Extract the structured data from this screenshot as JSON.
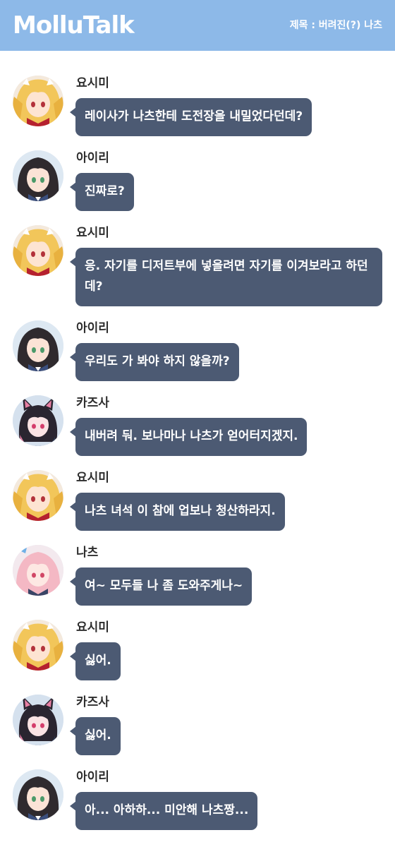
{
  "header": {
    "app_title": "MolluTalk",
    "subject": "제목 : 버려진(?) 나츠"
  },
  "messages": [
    {
      "sender": "요시미",
      "avatar_icon": "yoshimi-avatar-icon",
      "text": "레이사가 나츠한테 도전장을 내밀었다던데?"
    },
    {
      "sender": "아이리",
      "avatar_icon": "airi-avatar-icon",
      "text": "진짜로?"
    },
    {
      "sender": "요시미",
      "avatar_icon": "yoshimi-avatar-icon",
      "text": "응. 자기를 디저트부에 넣을려면 자기를 이겨보라고 하던데?"
    },
    {
      "sender": "아이리",
      "avatar_icon": "airi-avatar-icon",
      "text": "우리도 가 봐야 하지 않을까?"
    },
    {
      "sender": "카즈사",
      "avatar_icon": "kazusa-avatar-icon",
      "text": "내버려 둬. 보나마나 나츠가 얻어터지겠지."
    },
    {
      "sender": "요시미",
      "avatar_icon": "yoshimi-avatar-icon",
      "text": "나츠 녀석 이 참에 업보나 청산하라지."
    },
    {
      "sender": "나츠",
      "avatar_icon": "natsu-avatar-icon",
      "text": "여~ 모두들 나 좀 도와주게나~"
    },
    {
      "sender": "요시미",
      "avatar_icon": "yoshimi-avatar-icon",
      "text": "싫어."
    },
    {
      "sender": "카즈사",
      "avatar_icon": "kazusa-avatar-icon",
      "text": "싫어."
    },
    {
      "sender": "아이리",
      "avatar_icon": "airi-avatar-icon",
      "text": "아... 아하하... 미안해 나츠짱..."
    }
  ],
  "colors": {
    "header_bg": "#8db9e8",
    "bubble_bg": "#4c5a73",
    "bubble_text": "#ffffff",
    "sender_text": "#2d2d2d"
  }
}
